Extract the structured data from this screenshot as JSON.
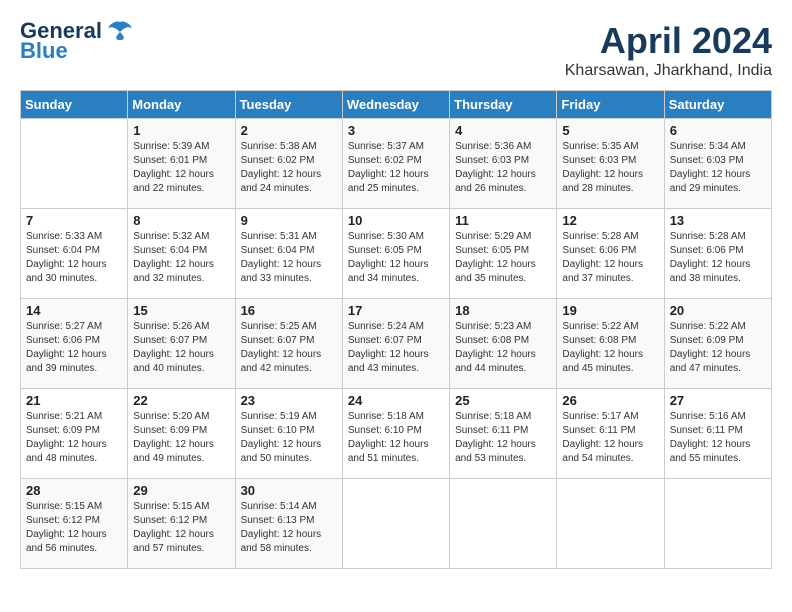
{
  "header": {
    "logo_general": "General",
    "logo_blue": "Blue",
    "month": "April 2024",
    "location": "Kharsawan, Jharkhand, India"
  },
  "weekdays": [
    "Sunday",
    "Monday",
    "Tuesday",
    "Wednesday",
    "Thursday",
    "Friday",
    "Saturday"
  ],
  "weeks": [
    [
      {
        "day": "",
        "info": ""
      },
      {
        "day": "1",
        "info": "Sunrise: 5:39 AM\nSunset: 6:01 PM\nDaylight: 12 hours\nand 22 minutes."
      },
      {
        "day": "2",
        "info": "Sunrise: 5:38 AM\nSunset: 6:02 PM\nDaylight: 12 hours\nand 24 minutes."
      },
      {
        "day": "3",
        "info": "Sunrise: 5:37 AM\nSunset: 6:02 PM\nDaylight: 12 hours\nand 25 minutes."
      },
      {
        "day": "4",
        "info": "Sunrise: 5:36 AM\nSunset: 6:03 PM\nDaylight: 12 hours\nand 26 minutes."
      },
      {
        "day": "5",
        "info": "Sunrise: 5:35 AM\nSunset: 6:03 PM\nDaylight: 12 hours\nand 28 minutes."
      },
      {
        "day": "6",
        "info": "Sunrise: 5:34 AM\nSunset: 6:03 PM\nDaylight: 12 hours\nand 29 minutes."
      }
    ],
    [
      {
        "day": "7",
        "info": "Sunrise: 5:33 AM\nSunset: 6:04 PM\nDaylight: 12 hours\nand 30 minutes."
      },
      {
        "day": "8",
        "info": "Sunrise: 5:32 AM\nSunset: 6:04 PM\nDaylight: 12 hours\nand 32 minutes."
      },
      {
        "day": "9",
        "info": "Sunrise: 5:31 AM\nSunset: 6:04 PM\nDaylight: 12 hours\nand 33 minutes."
      },
      {
        "day": "10",
        "info": "Sunrise: 5:30 AM\nSunset: 6:05 PM\nDaylight: 12 hours\nand 34 minutes."
      },
      {
        "day": "11",
        "info": "Sunrise: 5:29 AM\nSunset: 6:05 PM\nDaylight: 12 hours\nand 35 minutes."
      },
      {
        "day": "12",
        "info": "Sunrise: 5:28 AM\nSunset: 6:06 PM\nDaylight: 12 hours\nand 37 minutes."
      },
      {
        "day": "13",
        "info": "Sunrise: 5:28 AM\nSunset: 6:06 PM\nDaylight: 12 hours\nand 38 minutes."
      }
    ],
    [
      {
        "day": "14",
        "info": "Sunrise: 5:27 AM\nSunset: 6:06 PM\nDaylight: 12 hours\nand 39 minutes."
      },
      {
        "day": "15",
        "info": "Sunrise: 5:26 AM\nSunset: 6:07 PM\nDaylight: 12 hours\nand 40 minutes."
      },
      {
        "day": "16",
        "info": "Sunrise: 5:25 AM\nSunset: 6:07 PM\nDaylight: 12 hours\nand 42 minutes."
      },
      {
        "day": "17",
        "info": "Sunrise: 5:24 AM\nSunset: 6:07 PM\nDaylight: 12 hours\nand 43 minutes."
      },
      {
        "day": "18",
        "info": "Sunrise: 5:23 AM\nSunset: 6:08 PM\nDaylight: 12 hours\nand 44 minutes."
      },
      {
        "day": "19",
        "info": "Sunrise: 5:22 AM\nSunset: 6:08 PM\nDaylight: 12 hours\nand 45 minutes."
      },
      {
        "day": "20",
        "info": "Sunrise: 5:22 AM\nSunset: 6:09 PM\nDaylight: 12 hours\nand 47 minutes."
      }
    ],
    [
      {
        "day": "21",
        "info": "Sunrise: 5:21 AM\nSunset: 6:09 PM\nDaylight: 12 hours\nand 48 minutes."
      },
      {
        "day": "22",
        "info": "Sunrise: 5:20 AM\nSunset: 6:09 PM\nDaylight: 12 hours\nand 49 minutes."
      },
      {
        "day": "23",
        "info": "Sunrise: 5:19 AM\nSunset: 6:10 PM\nDaylight: 12 hours\nand 50 minutes."
      },
      {
        "day": "24",
        "info": "Sunrise: 5:18 AM\nSunset: 6:10 PM\nDaylight: 12 hours\nand 51 minutes."
      },
      {
        "day": "25",
        "info": "Sunrise: 5:18 AM\nSunset: 6:11 PM\nDaylight: 12 hours\nand 53 minutes."
      },
      {
        "day": "26",
        "info": "Sunrise: 5:17 AM\nSunset: 6:11 PM\nDaylight: 12 hours\nand 54 minutes."
      },
      {
        "day": "27",
        "info": "Sunrise: 5:16 AM\nSunset: 6:11 PM\nDaylight: 12 hours\nand 55 minutes."
      }
    ],
    [
      {
        "day": "28",
        "info": "Sunrise: 5:15 AM\nSunset: 6:12 PM\nDaylight: 12 hours\nand 56 minutes."
      },
      {
        "day": "29",
        "info": "Sunrise: 5:15 AM\nSunset: 6:12 PM\nDaylight: 12 hours\nand 57 minutes."
      },
      {
        "day": "30",
        "info": "Sunrise: 5:14 AM\nSunset: 6:13 PM\nDaylight: 12 hours\nand 58 minutes."
      },
      {
        "day": "",
        "info": ""
      },
      {
        "day": "",
        "info": ""
      },
      {
        "day": "",
        "info": ""
      },
      {
        "day": "",
        "info": ""
      }
    ]
  ]
}
